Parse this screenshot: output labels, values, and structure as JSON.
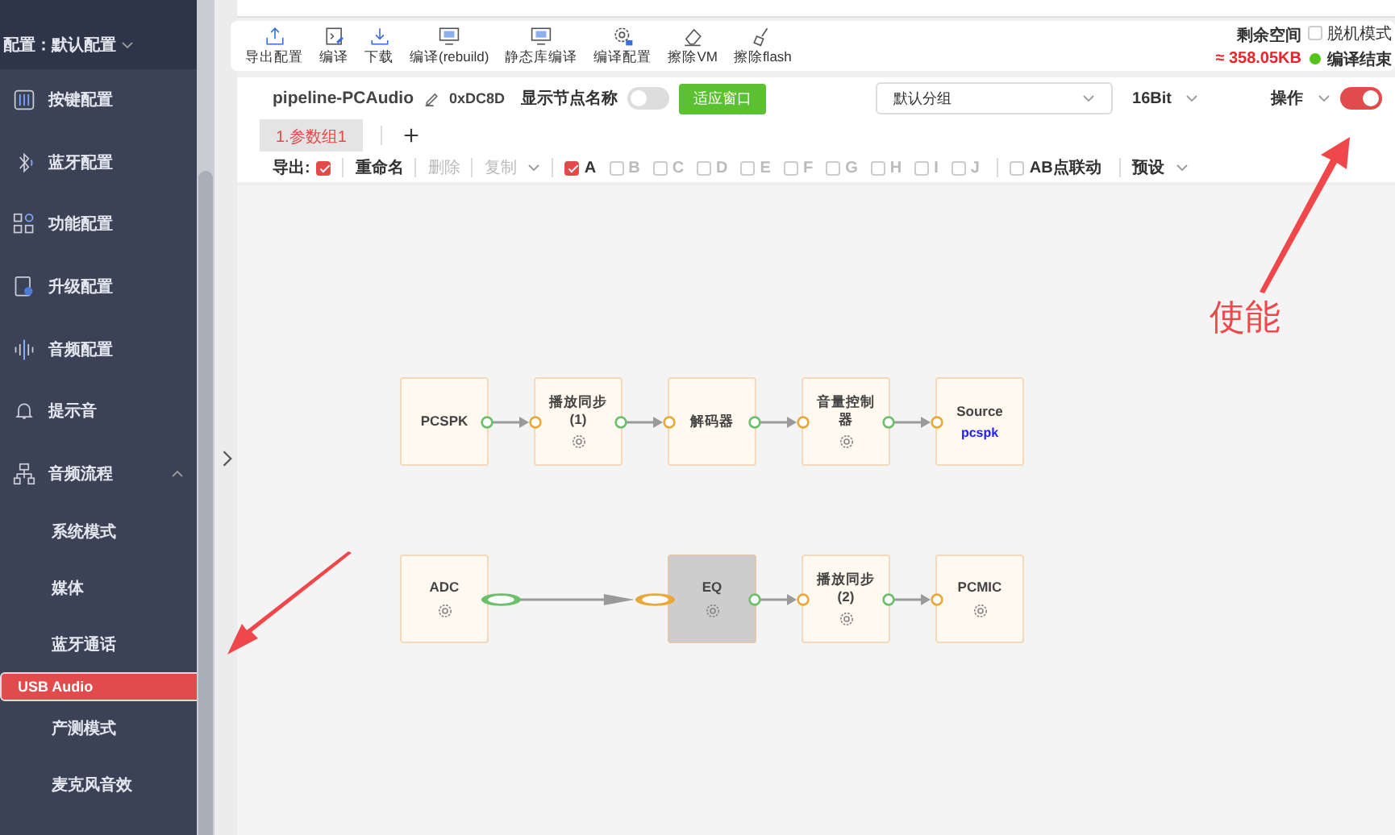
{
  "sidebar": {
    "config_label": "配置：默认配置",
    "items": [
      {
        "label": "按键配置"
      },
      {
        "label": "蓝牙配置"
      },
      {
        "label": "功能配置"
      },
      {
        "label": "升级配置"
      },
      {
        "label": "音频配置"
      },
      {
        "label": "提示音"
      },
      {
        "label": "音频流程",
        "expanded": true,
        "children": [
          {
            "label": "系统模式",
            "selected": false
          },
          {
            "label": "媒体",
            "selected": false
          },
          {
            "label": "蓝牙通话",
            "selected": false
          },
          {
            "label": "USB Audio",
            "selected": true
          },
          {
            "label": "产测模式",
            "selected": false
          },
          {
            "label": "麦克风音效",
            "selected": false
          }
        ]
      }
    ]
  },
  "toolbar": {
    "buttons": [
      {
        "label": "导出配置"
      },
      {
        "label": "编译"
      },
      {
        "label": "下载"
      },
      {
        "label": "编译(rebuild)"
      },
      {
        "label": "静态库编译"
      },
      {
        "label": "编译配置"
      },
      {
        "label": "擦除VM"
      },
      {
        "label": "擦除flash"
      }
    ],
    "space_label": "剩余空间",
    "space_value": "≈ 358.05KB",
    "offline": {
      "label": "脱机模式",
      "checked": false
    },
    "status": {
      "label": "编译结束",
      "color": "#52c41a"
    }
  },
  "pipeline": {
    "name": "pipeline-PCAudio",
    "code": "0xDC8D",
    "show_names": {
      "label": "显示节点名称",
      "on": false
    },
    "fit_button": "适应窗口",
    "group_select": "默认分组",
    "bit_select": "16Bit",
    "operation": "操作",
    "enabled": true
  },
  "tabs": [
    {
      "label": "1.参数组1",
      "selected": true
    }
  ],
  "options": {
    "export_label": "导出:",
    "export_checked": true,
    "rename": "重命名",
    "delete": "删除",
    "copy": "复制",
    "channels": [
      {
        "label": "A",
        "checked": true
      },
      {
        "label": "B",
        "checked": false
      },
      {
        "label": "C",
        "checked": false
      },
      {
        "label": "D",
        "checked": false
      },
      {
        "label": "E",
        "checked": false
      },
      {
        "label": "F",
        "checked": false
      },
      {
        "label": "G",
        "checked": false
      },
      {
        "label": "H",
        "checked": false
      },
      {
        "label": "I",
        "checked": false
      },
      {
        "label": "J",
        "checked": false
      }
    ],
    "ab_link": {
      "label": "AB点联动",
      "checked": false
    },
    "preset": "预设"
  },
  "graph": {
    "rows": [
      [
        {
          "label": "PCSPK",
          "settings": false,
          "selected": false
        },
        {
          "label": "播放同步 (1)",
          "settings": true,
          "selected": false
        },
        {
          "label": "解码器",
          "settings": false,
          "selected": false
        },
        {
          "label": "音量控制器",
          "settings": true,
          "selected": false
        },
        {
          "label": "Source",
          "sub": "pcspk",
          "settings": false,
          "selected": false
        }
      ],
      [
        {
          "label": "ADC",
          "settings": true,
          "selected": false
        },
        "",
        {
          "label": "EQ",
          "settings": true,
          "selected": true
        },
        {
          "label": "播放同步 (2)",
          "settings": true,
          "selected": false
        },
        {
          "label": "PCMIC",
          "settings": true,
          "selected": false
        }
      ]
    ]
  },
  "annotation": {
    "text": "使能"
  }
}
